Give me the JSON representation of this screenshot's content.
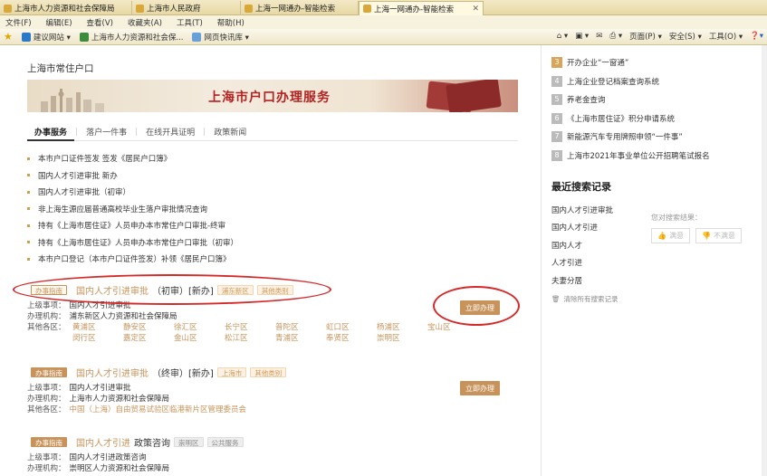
{
  "browser": {
    "tabs": [
      {
        "label": "上海市人力资源和社会保障局"
      },
      {
        "label": "上海市人民政府"
      },
      {
        "label": "上海一网通办-智能检索"
      },
      {
        "label": "上海一网通办-智能检索"
      }
    ],
    "menu": [
      "文件(F)",
      "编辑(E)",
      "查看(V)",
      "收藏夹(A)",
      "工具(T)",
      "帮助(H)"
    ],
    "favorites": [
      "建议网站 ▾",
      "上海市人力资源和社会保...",
      "网页快讯库 ▾"
    ],
    "tools": [
      "页面(P) ▾",
      "安全(S) ▾",
      "工具(O) ▾"
    ]
  },
  "page": {
    "title": "上海市常住户口",
    "banner_title": "上海市户口办理服务",
    "nav": [
      "办事服务",
      "落户一件事",
      "在线开具证明",
      "政策新闻"
    ],
    "quick_links": [
      "本市户口证件签发 签发《居民户口簿》",
      "国内人才引进审批 新办",
      "国内人才引进审批（初审）",
      "非上海生源应届普通高校毕业生落户审批情况查询",
      "持有《上海市居住证》人员申办本市常住户口审批-终审",
      "持有《上海市居住证》人员申办本市常住户口审批（初审）",
      "本市户口登记（本市户口证件签发）补领《居民户口簿》"
    ],
    "results": [
      {
        "guide": "办事指南",
        "title_hl": "国内人才引进审批",
        "title_rest": "（初审）[新办]",
        "tags": [
          "浦东新区",
          "其他类别"
        ],
        "parent_label": "上级事项：",
        "parent": "国内人才引进审批",
        "org_label": "办理机构：",
        "org": "浦东新区人力资源和社会保障局",
        "other_label": "其他各区：",
        "districts": [
          "黄浦区",
          "静安区",
          "徐汇区",
          "长宁区",
          "普陀区",
          "虹口区",
          "杨浦区",
          "宝山区",
          "闵行区",
          "嘉定区",
          "金山区",
          "松江区",
          "青浦区",
          "奉贤区",
          "崇明区"
        ],
        "button": "立即办理"
      },
      {
        "guide": "办事指南",
        "title_hl": "国内人才引进审批",
        "title_rest": "（终审）[新办]",
        "tags": [
          "上海市",
          "其他类别"
        ],
        "parent_label": "上级事项：",
        "parent": "国内人才引进审批",
        "org_label": "办理机构：",
        "org": "上海市人力资源和社会保障局",
        "other_label": "其他各区：",
        "other": "中国（上海）自由贸易试验区临港新片区管理委员会",
        "button": "立即办理"
      },
      {
        "guide": "办事指南",
        "title_hl": "国内人才引进",
        "title_rest": "政策咨询",
        "tags": [
          "崇明区",
          "公共服务"
        ],
        "parent_label": "上级事项：",
        "parent": "国内人才引进政策咨询",
        "org_label": "办理机构：",
        "org": "崇明区人力资源和社会保障局"
      }
    ]
  },
  "sidebar": {
    "hot": [
      {
        "n": "3",
        "label": "开办企业“一窗通”"
      },
      {
        "n": "4",
        "label": "上海企业登记档案查询系统"
      },
      {
        "n": "5",
        "label": "养老金查询"
      },
      {
        "n": "6",
        "label": "《上海市居住证》积分申请系统"
      },
      {
        "n": "7",
        "label": "新能源汽车专用牌照申领“一件事”"
      },
      {
        "n": "8",
        "label": "上海市2021年事业单位公开招聘笔试报名"
      }
    ],
    "recent_title": "最近搜索记录",
    "recent": [
      "国内人才引进审批",
      "国内人才引进",
      "国内人才",
      "人才引进",
      "夫妻分居"
    ],
    "feedback_prompt": "您对搜索结果：",
    "satisfied": "满意",
    "unsatisfied": "不满意",
    "clear": "清除所有搜索记录"
  },
  "colors": {
    "accent": "#c7935a",
    "banner_red": "#b12323",
    "annotation": "#d42a2a"
  }
}
